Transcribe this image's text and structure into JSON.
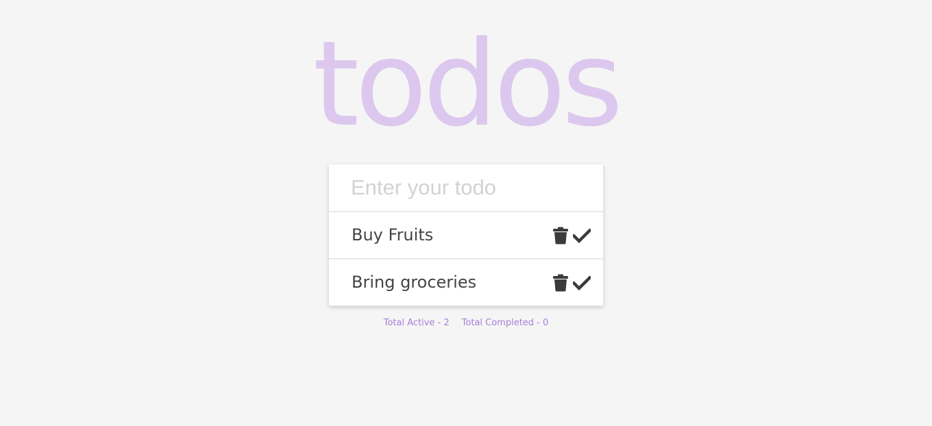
{
  "app": {
    "title": "todos",
    "accent_color": "#a77fd8",
    "title_color": "#dcc8ee"
  },
  "input": {
    "placeholder": "Enter your todo",
    "value": ""
  },
  "todos": [
    {
      "text": "Buy Fruits",
      "completed": false,
      "delete_icon": "trash-icon",
      "complete_icon": "check-icon"
    },
    {
      "text": "Bring groceries",
      "completed": false,
      "delete_icon": "trash-icon",
      "complete_icon": "check-icon"
    }
  ],
  "stats": {
    "total_active": "Total Active - 2",
    "total_completed": "Total Completed - 0"
  }
}
